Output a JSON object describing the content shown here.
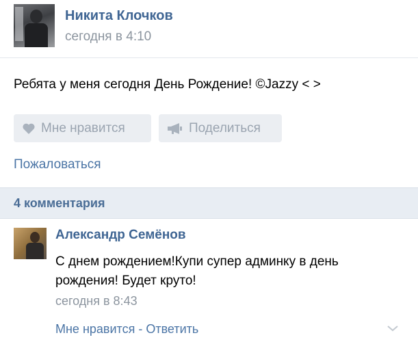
{
  "post": {
    "author": "Никита Клочков",
    "time": "сегодня в 4:10",
    "text": "Ребята у меня сегодня День Рождение! ©Jazzy < >",
    "like_label": "Мне нравится",
    "share_label": "Поделиться",
    "report_label": "Пожаловаться"
  },
  "comments": {
    "count_label": "4 комментария",
    "items": [
      {
        "author": "Александр Семёнов",
        "text": "С днем рождением!Купи супер админку в день рождения! Будет круто!",
        "time": "сегодня в 8:43",
        "like_label": "Мне нравится",
        "separator": " - ",
        "reply_label": "Ответить"
      }
    ]
  },
  "icons": {
    "like": "heart-icon",
    "share": "megaphone-icon",
    "expand": "chevron-down-icon"
  },
  "colors": {
    "link": "#3f6593",
    "muted": "#8b949e",
    "button_bg": "#ebeef2",
    "section_bg": "#e8edf3"
  }
}
